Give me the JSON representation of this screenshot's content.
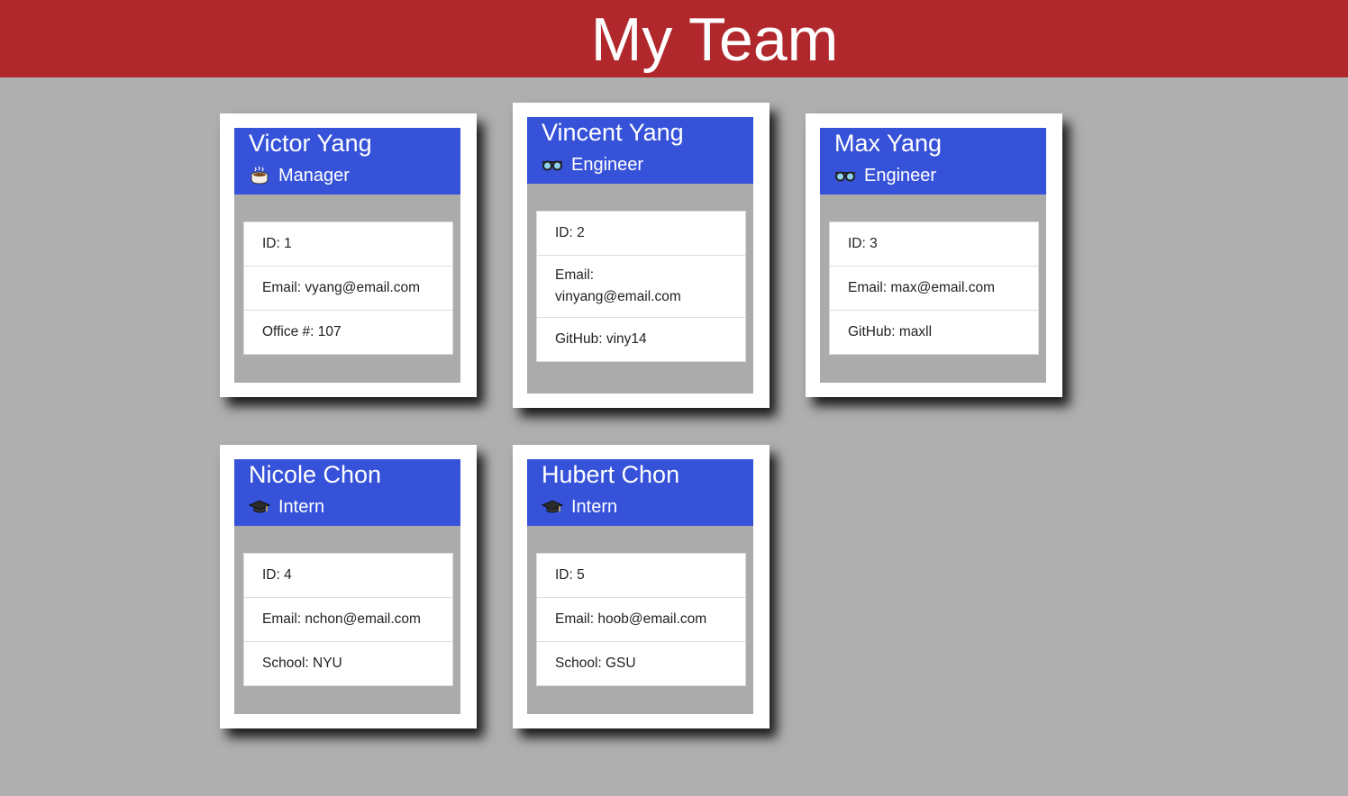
{
  "page": {
    "title": "My Team"
  },
  "team": [
    {
      "name": "Victor Yang",
      "role": "Manager",
      "icon": "coffee-icon",
      "id_label": "ID: 1",
      "email_label": "Email: vyang@email.com",
      "extra_label": "Office #: 107"
    },
    {
      "name": "Vincent Yang",
      "role": "Engineer",
      "icon": "glasses-icon",
      "id_label": "ID: 2",
      "email_label": "Email:",
      "email_value": "vinyang@email.com",
      "extra_label": "GitHub: viny14"
    },
    {
      "name": "Max Yang",
      "role": "Engineer",
      "icon": "glasses-icon",
      "id_label": "ID: 3",
      "email_label": "Email: max@email.com",
      "extra_label": "GitHub: maxll"
    },
    {
      "name": "Nicole Chon",
      "role": "Intern",
      "icon": "graduation-cap-icon",
      "id_label": "ID: 4",
      "email_label": "Email: nchon@email.com",
      "extra_label": "School: NYU"
    },
    {
      "name": "Hubert Chon",
      "role": "Intern",
      "icon": "graduation-cap-icon",
      "id_label": "ID: 5",
      "email_label": "Email: hoob@email.com",
      "extra_label": "School: GSU"
    }
  ],
  "colors": {
    "header": "#b0282c",
    "card_head": "#3652d9",
    "background": "#b0afb0"
  }
}
